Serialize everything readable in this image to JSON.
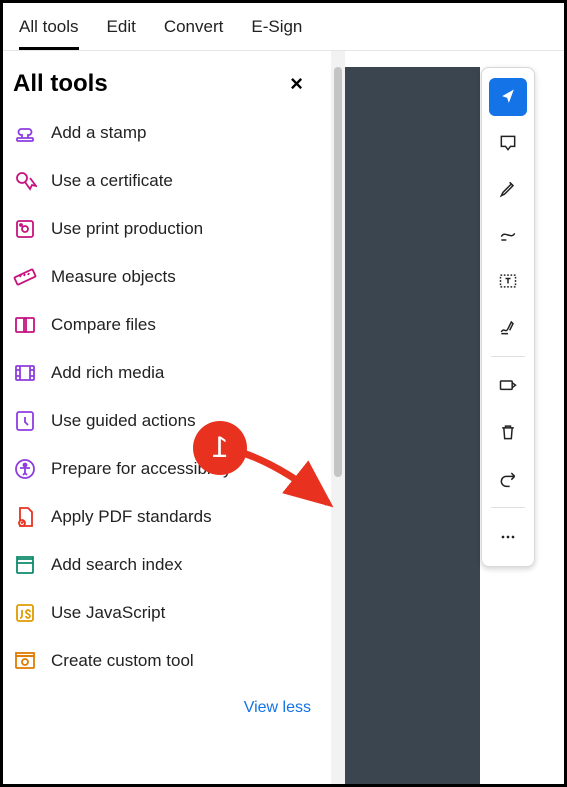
{
  "tabs": {
    "all_tools": "All tools",
    "edit": "Edit",
    "convert": "Convert",
    "esign": "E-Sign"
  },
  "panel": {
    "title": "All tools",
    "close": "×",
    "view_less": "View less"
  },
  "tools": {
    "stamp": "Add a stamp",
    "certificate": "Use a certificate",
    "print_prod": "Use print production",
    "measure": "Measure objects",
    "compare": "Compare files",
    "rich_media": "Add rich media",
    "guided": "Use guided actions",
    "accessibility": "Prepare for accessibility",
    "pdf_standards": "Apply PDF standards",
    "search_index": "Add search index",
    "javascript": "Use JavaScript",
    "custom_tool": "Create custom tool"
  },
  "annotation": {
    "badge": "1"
  }
}
